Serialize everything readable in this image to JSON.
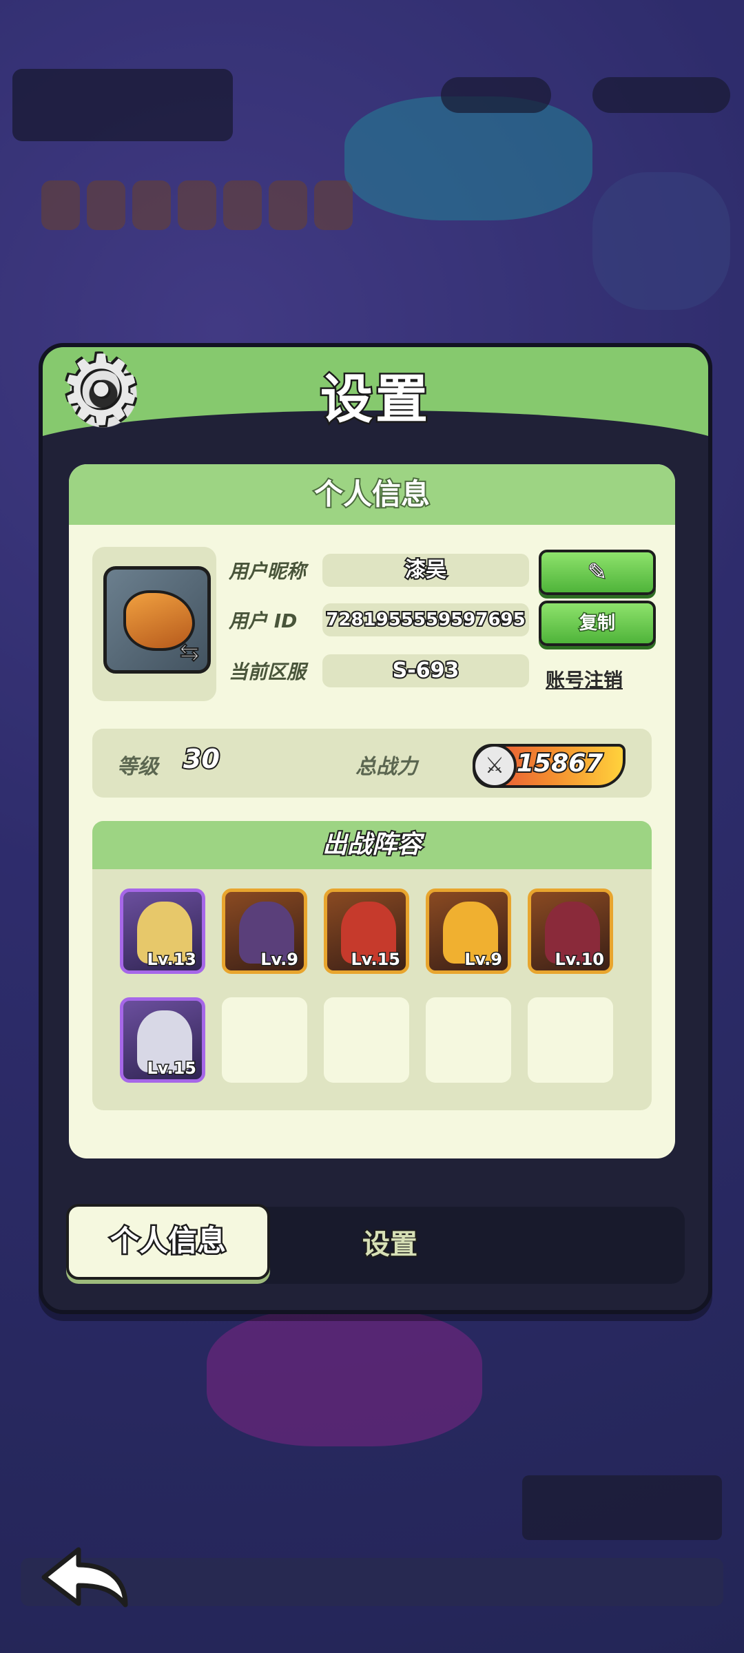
{
  "dialog": {
    "title": "设置",
    "card_header": "个人信息",
    "nickname_label": "用户昵称",
    "nickname_value": "漆吴",
    "userid_label": "用户 ID",
    "userid_value": "7281955559597695",
    "server_label": "当前区服",
    "server_value": "S-693",
    "copy_button": "复制",
    "cancel_account_link": "账号注销",
    "level_label": "等级",
    "level_value": "30",
    "power_label": "总战力",
    "power_value": "15867",
    "lineup_header": "出战阵容",
    "heroes": [
      {
        "level": "Lv.13",
        "rarity": "purple",
        "color": "#e7c86a"
      },
      {
        "level": "Lv.9",
        "rarity": "orange",
        "color": "#5a3f7a"
      },
      {
        "level": "Lv.15",
        "rarity": "orange",
        "color": "#c63a2c"
      },
      {
        "level": "Lv.9",
        "rarity": "orange",
        "color": "#f0b030"
      },
      {
        "level": "Lv.10",
        "rarity": "orange",
        "color": "#8a2a3a"
      },
      {
        "level": "Lv.15",
        "rarity": "purple",
        "color": "#d8d8e6"
      }
    ],
    "tabs": {
      "active": "个人信息",
      "inactive": "设置"
    }
  },
  "colors": {
    "accent_green": "#86c96e",
    "panel_dark": "#202137",
    "card_bg": "#f5f8df"
  }
}
